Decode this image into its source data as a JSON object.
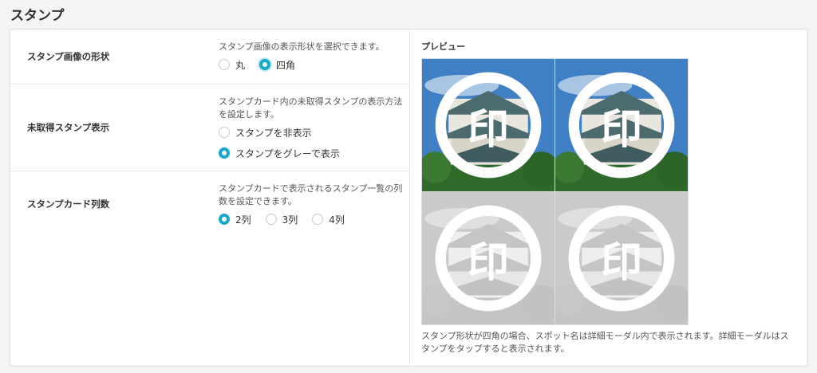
{
  "header": {
    "title": "スタンプ"
  },
  "settings": {
    "shape": {
      "label": "スタンプ画像の形状",
      "description": "スタンプ画像の表示形状を選択できます。",
      "options": [
        "丸",
        "四角"
      ],
      "selected": "四角"
    },
    "unacquired": {
      "label": "未取得スタンプ表示",
      "description": "スタンプカード内の未取得スタンプの表示方法を設定します。",
      "options": [
        "スタンプを非表示",
        "スタンプをグレーで表示"
      ],
      "selected": "スタンプをグレーで表示"
    },
    "columns": {
      "label": "スタンプカード列数",
      "description": "スタンプカードで表示されるスタンプ一覧の列数を設定できます。",
      "options": [
        "2列",
        "3列",
        "4列"
      ],
      "selected": "2列"
    }
  },
  "preview": {
    "label": "プレビュー",
    "stamp_glyph": "印",
    "tiles": [
      "acquired",
      "acquired",
      "gray",
      "gray"
    ],
    "note": "スタンプ形状が四角の場合、スポット名は詳細モーダル内で表示されます。詳細モーダルはスタンプをタップすると表示されます。"
  },
  "colors": {
    "accent": "#17a9c9",
    "sky": "#3f7fc4",
    "foliage": "#2f6a2b"
  }
}
